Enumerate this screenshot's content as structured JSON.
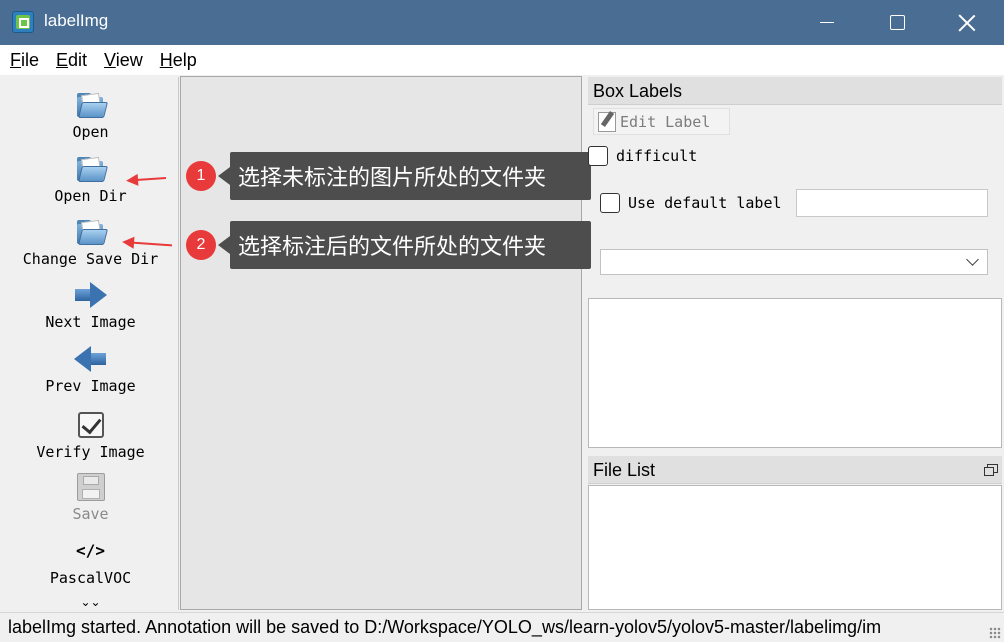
{
  "window": {
    "title": "labelImg"
  },
  "menu": [
    "File",
    "Edit",
    "View",
    "Help"
  ],
  "toolbar": {
    "open": "Open",
    "open_dir": "Open Dir",
    "change_save_dir": "Change Save Dir",
    "next_image": "Next Image",
    "prev_image": "Prev Image",
    "verify_image": "Verify Image",
    "save": "Save",
    "format_icon_text": "</>",
    "format": "PascalVOC",
    "more_chevron": "⌄⌄"
  },
  "annotations": [
    {
      "number": "1",
      "text": "选择未标注的图片所处的文件夹",
      "color": "#e8393b"
    },
    {
      "number": "2",
      "text": "选择标注后的文件所处的文件夹",
      "color": "#e8393b"
    }
  ],
  "box_labels": {
    "title": "Box Labels",
    "edit_label": "Edit Label",
    "difficult": "difficult",
    "use_default_label": "Use default label",
    "default_label_value": "",
    "label_select_value": ""
  },
  "file_list": {
    "title": "File List"
  },
  "status": {
    "text": "labelImg started. Annotation will be saved to D:/Workspace/YOLO_ws/learn-yolov5/yolov5-master/labelimg/im"
  },
  "colors": {
    "titlebar": "#4a6e93",
    "accent_red": "#e8393b",
    "callout_bg": "#4d4d4d"
  }
}
